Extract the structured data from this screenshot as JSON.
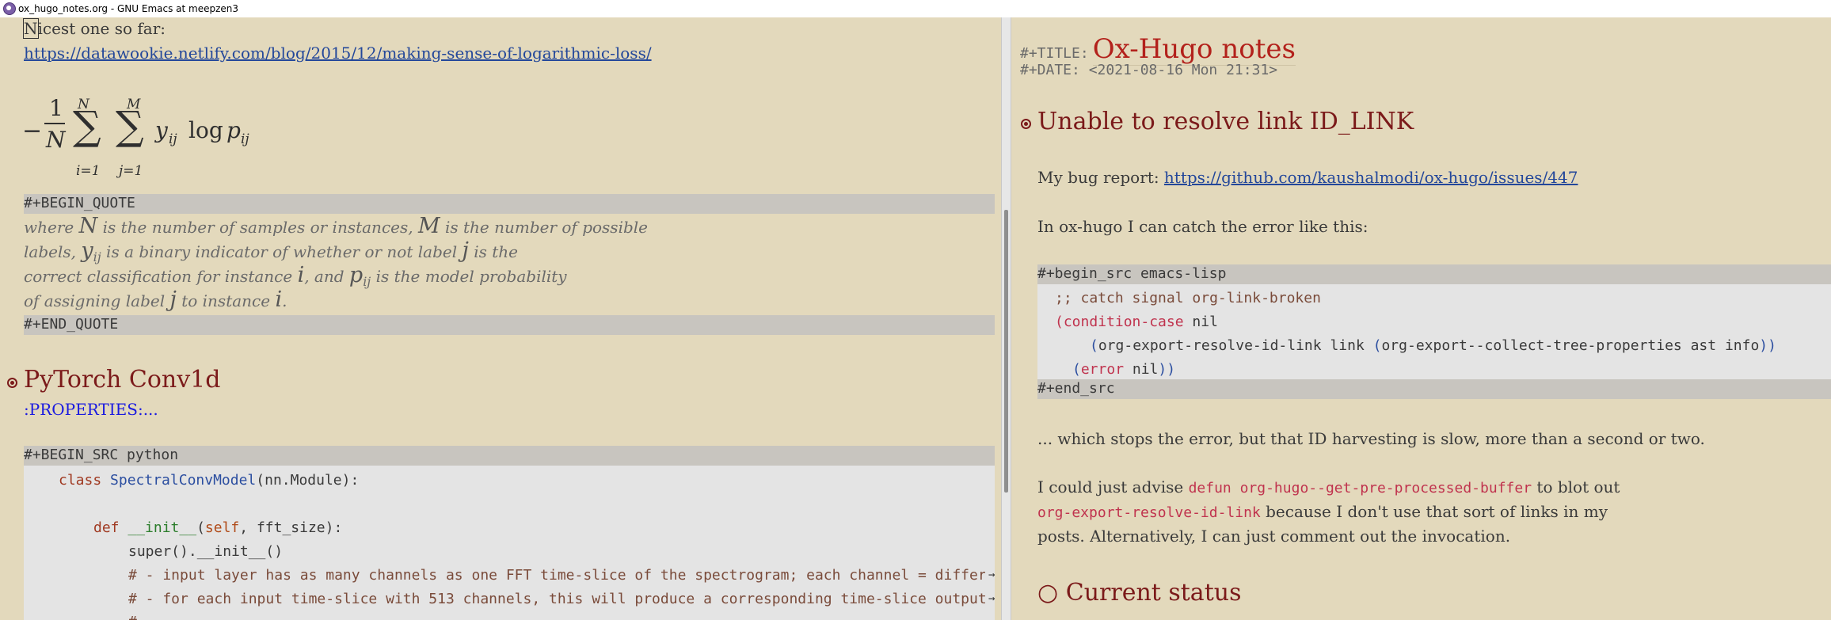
{
  "window": {
    "title": "ox_hugo_notes.org - GNU Emacs at meepzen3"
  },
  "left": {
    "line1": {
      "cursor_char": "N",
      "rest": "icest one so far:"
    },
    "link": "https://datawookie.netlify.com/blog/2015/12/making-sense-of-logarithmic-loss/",
    "formula": {
      "minus": "−",
      "num": "1",
      "den": "N",
      "sum": "∑",
      "sup1": "N",
      "sub1": "i=1",
      "sup2": "M",
      "sub2": "j=1",
      "body": "y",
      "body_sub": "ij",
      "log": "log",
      "p": "p",
      "p_sub": "ij"
    },
    "begin_quote": "#+BEGIN_QUOTE",
    "quote": {
      "l1a": "where ",
      "l1m1": "N",
      "l1b": " is the number of samples or instances, ",
      "l1m2": "M",
      "l1c": " is the number of possible",
      "l2a": "labels, ",
      "l2m1": "y",
      "l2m1s": "ij",
      "l2b": " is a binary indicator of whether or not label ",
      "l2m2": "j",
      "l2c": " is the",
      "l3a": "correct classification for instance ",
      "l3m1": "i",
      "l3b": ", and ",
      "l3m2": "p",
      "l3m2s": "ij",
      "l3c": " is the model probability",
      "l4a": "of assigning label ",
      "l4m1": "j",
      "l4b": " to instance ",
      "l4m2": "i",
      "l4c": "."
    },
    "end_quote": "#+END_QUOTE",
    "heading": "PyTorch Conv1d",
    "properties": ":PROPERTIES:...",
    "begin_src": "#+BEGIN_SRC python",
    "code": {
      "c1_kw": "class ",
      "c1_cls": "SpectralConvModel",
      "c1_rest": "(nn.Module):",
      "c2_kw": "def ",
      "c2_fn": "__init__",
      "c2_p1": "(",
      "c2_self": "self",
      "c2_rest": ", fft_size):",
      "c3": "super().__init__()",
      "c4": "# - input layer has as many channels as one FFT time-slice of the spectrogram; each channel = differ",
      "c5": "# - for each input time-slice with 513 channels, this will produce a corresponding time-slice output",
      "c6": "# ..."
    }
  },
  "right": {
    "title_kw": "#+TITLE:",
    "title": "Ox-Hugo notes",
    "date_kw": "#+DATE:",
    "date": "<2021-08-16 Mon 21:31>",
    "heading1": "Unable to resolve link ID_LINK",
    "bug_label": "My bug report: ",
    "bug_link": "https://github.com/kaushalmodi/ox-hugo/issues/447",
    "catch_text": "In ox-hugo I can catch the error like this:",
    "begin_src": "#+begin_src emacs-lisp",
    "code": {
      "l1": ";; catch signal org-link-broken",
      "l2_p": "(",
      "l2_kw": "condition-case",
      "l2_rest": " nil",
      "l3_p": "(",
      "l3_rest": "org-export-resolve-id-link link ",
      "l3_p2": "(",
      "l3_rest2": "org-export--collect-tree-properties ast info",
      "l3_end": "))",
      "l4_p": "(",
      "l4_kw": "error",
      "l4_rest": " nil",
      "l4_end": "))"
    },
    "end_src": "#+end_src",
    "stops_text": "... which stops the error, but that ID harvesting is slow, more than a second or two.",
    "advise": {
      "a": "I could just advise ",
      "defun": "defun org-hugo--get-pre-processed-buffer",
      "b": " to blot out",
      "fn": "org-export-resolve-id-link",
      "c": " because I don't use that sort of links in my",
      "d": "posts. Alternatively, I can just comment out the invocation."
    },
    "heading2_bullet": "○",
    "heading2": "Current status"
  },
  "colors": {
    "background": "#e3d9bc",
    "heading": "#7b1a1a",
    "link": "#23479a",
    "keyword": "#c0334e",
    "property": "#1a1ae0",
    "band": "#c8c5bf"
  }
}
